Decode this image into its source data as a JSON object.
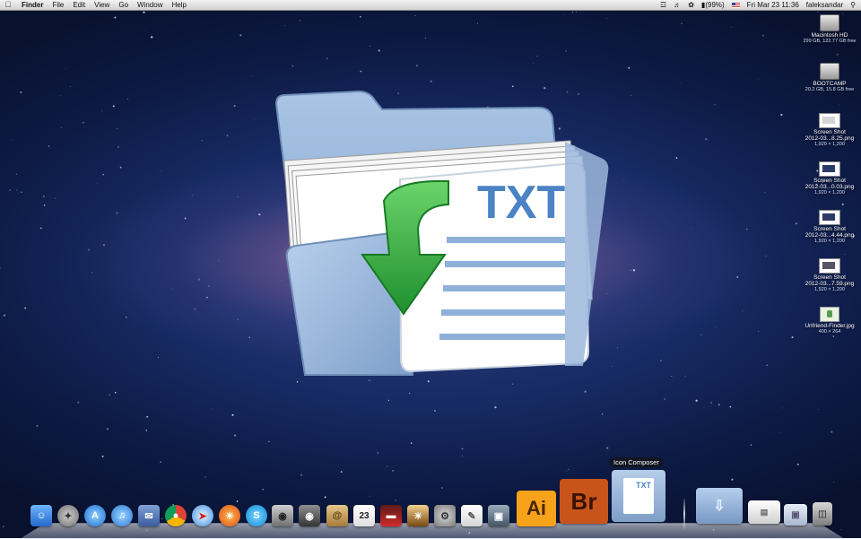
{
  "menubar": {
    "app_name": "Finder",
    "menus": [
      "File",
      "Edit",
      "View",
      "Go",
      "Window",
      "Help"
    ],
    "battery": "(99%)",
    "datetime": "Fri Mar 23  11:36",
    "user": "faleksandar"
  },
  "featured_icon": {
    "label": "TXT"
  },
  "desktop_items": [
    {
      "label": "Macintosh HD",
      "sub": "299 GB, 122.77 GB free"
    },
    {
      "label": "BOOTCAMP",
      "sub": "20.2 GB, 15.8 GB free"
    },
    {
      "label": "Screen Shot",
      "label2": "2012-03...8.25.png",
      "sub": "1,920 × 1,200"
    },
    {
      "label": "Screen Shot",
      "label2": "2012-03...0.03.png",
      "sub": "1,920 × 1,200"
    },
    {
      "label": "Screen Shot",
      "label2": "2012-03...4.44.png",
      "sub": "1,920 × 1,200"
    },
    {
      "label": "Screen Shot",
      "label2": "2012-03...7.59.png",
      "sub": "1,920 × 1,200"
    },
    {
      "label": "Unfriend-Finder.jpg",
      "sub": "400 × 264"
    }
  ],
  "dock": {
    "tooltip": "Icon Composer",
    "calendar_day": "23",
    "illustrator_label": "Ai",
    "bridge_label": "Br",
    "icon_composer_label": "TXT",
    "colors": {
      "illustrator": "#f7a21b",
      "bridge": "#c8541c"
    }
  }
}
